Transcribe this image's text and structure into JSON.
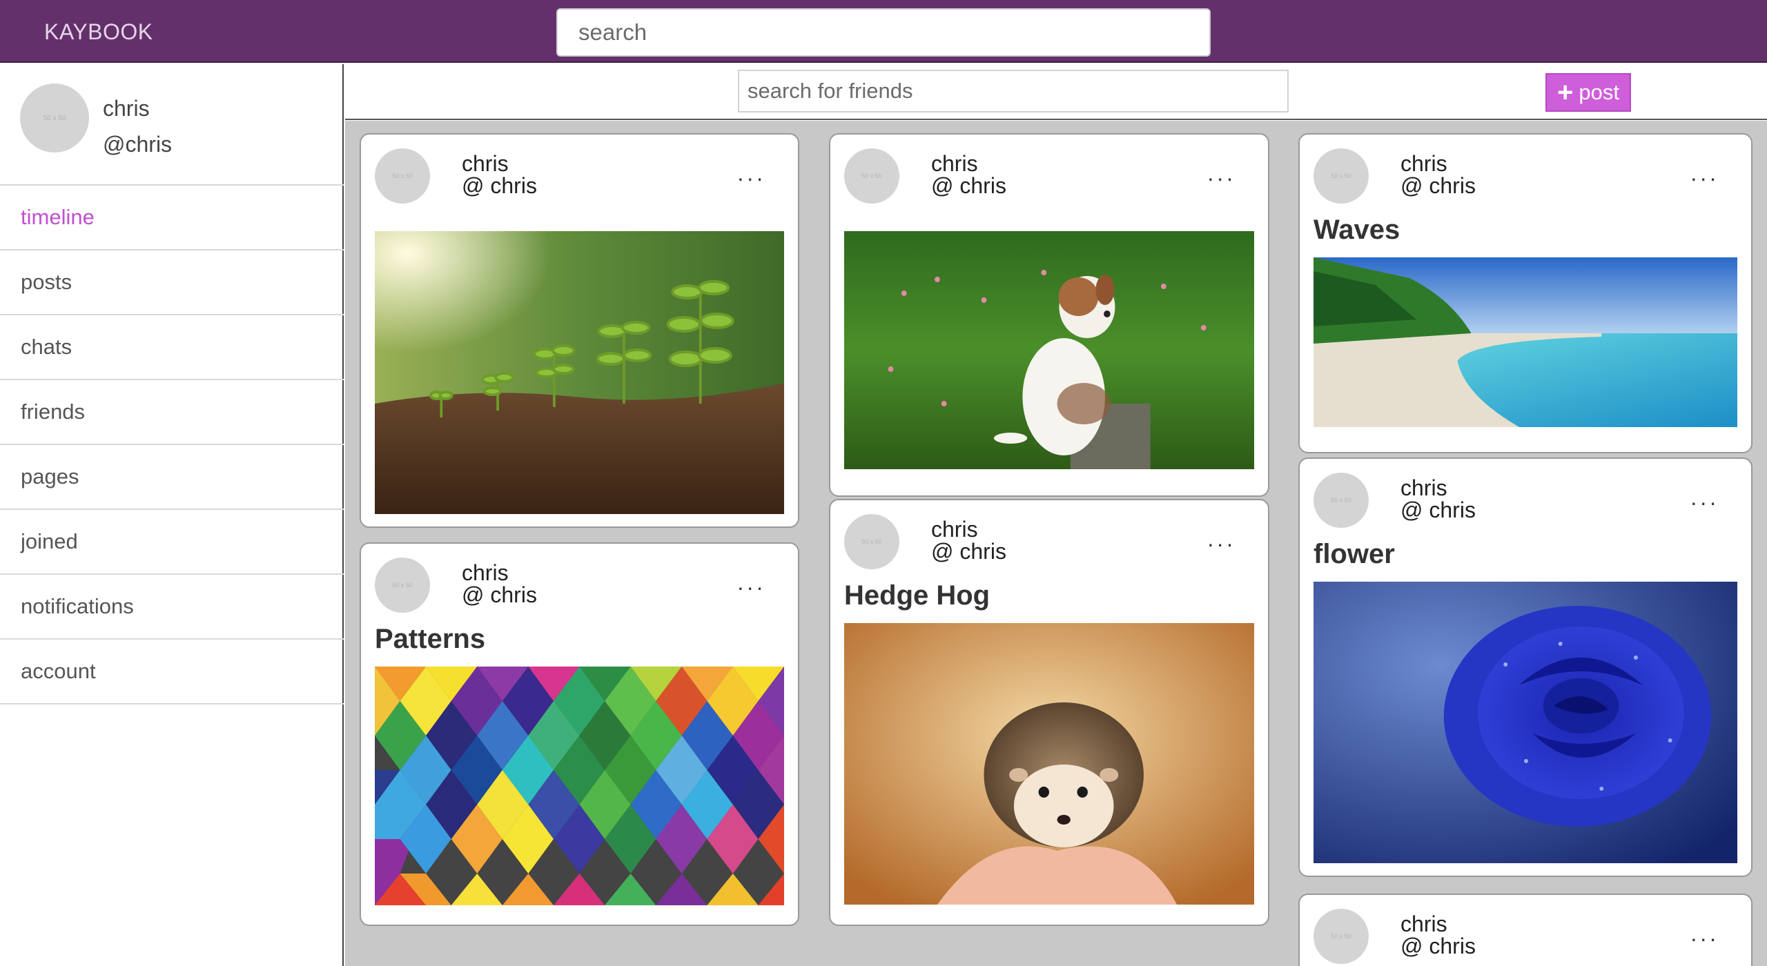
{
  "header": {
    "brand": "KAYBOOK",
    "search_placeholder": "search"
  },
  "sidebar": {
    "profile": {
      "avatar_text": "50 x 50",
      "name": "chris",
      "handle": "@chris"
    },
    "items": [
      {
        "label": "timeline",
        "active": true
      },
      {
        "label": "posts"
      },
      {
        "label": "chats"
      },
      {
        "label": "friends"
      },
      {
        "label": "pages"
      },
      {
        "label": "joined"
      },
      {
        "label": "notifications"
      },
      {
        "label": "account"
      }
    ]
  },
  "toolbar": {
    "friend_search_placeholder": "search for friends",
    "post_button_label": "post",
    "post_button_icon": "plus-icon"
  },
  "posts": [
    {
      "name": "chris",
      "handle": "@ chris",
      "avatar_text": "50 x 50",
      "more": "...",
      "title": "",
      "image": "seedlings growing in soil"
    },
    {
      "name": "chris",
      "handle": "@ chris",
      "avatar_text": "50 x 50",
      "more": "...",
      "title": "",
      "image": "puppy sitting in grass"
    },
    {
      "name": "chris",
      "handle": "@ chris",
      "avatar_text": "50 x 50",
      "more": "...",
      "title": "Waves",
      "image": "tropical beach"
    },
    {
      "name": "chris",
      "handle": "@ chris",
      "avatar_text": "50 x 50",
      "more": "...",
      "title": "Patterns",
      "image": "colorful geometric pattern"
    },
    {
      "name": "chris",
      "handle": "@ chris",
      "avatar_text": "50 x 50",
      "more": "...",
      "title": "Hedge Hog",
      "image": "hedgehog in hand"
    },
    {
      "name": "chris",
      "handle": "@ chris",
      "avatar_text": "50 x 50",
      "more": "...",
      "title": "flower",
      "image": "blue rose with dew"
    },
    {
      "name": "chris",
      "handle": "@ chris",
      "avatar_text": "50 x 50",
      "more": "...",
      "title": "",
      "image": ""
    }
  ],
  "colors": {
    "header": "#64306b",
    "accent": "#cf5edb",
    "active_nav": "#c04fd0",
    "feed_bg": "#c8c8c8"
  }
}
